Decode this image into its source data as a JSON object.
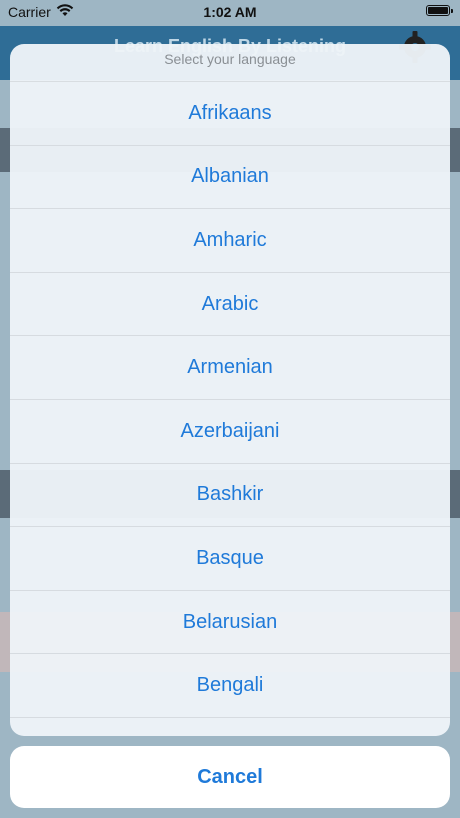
{
  "status_bar": {
    "carrier": "Carrier",
    "time": "1:02 AM"
  },
  "background_app": {
    "title": "Learn English By Listening"
  },
  "action_sheet": {
    "title": "Select your language",
    "options": [
      "Afrikaans",
      "Albanian",
      "Amharic",
      "Arabic",
      "Armenian",
      "Azerbaijani",
      "Bashkir",
      "Basque",
      "Belarusian",
      "Bengali"
    ],
    "cancel_label": "Cancel"
  },
  "colors": {
    "accent": "#1f7ad9",
    "header": "#2f6d96"
  }
}
